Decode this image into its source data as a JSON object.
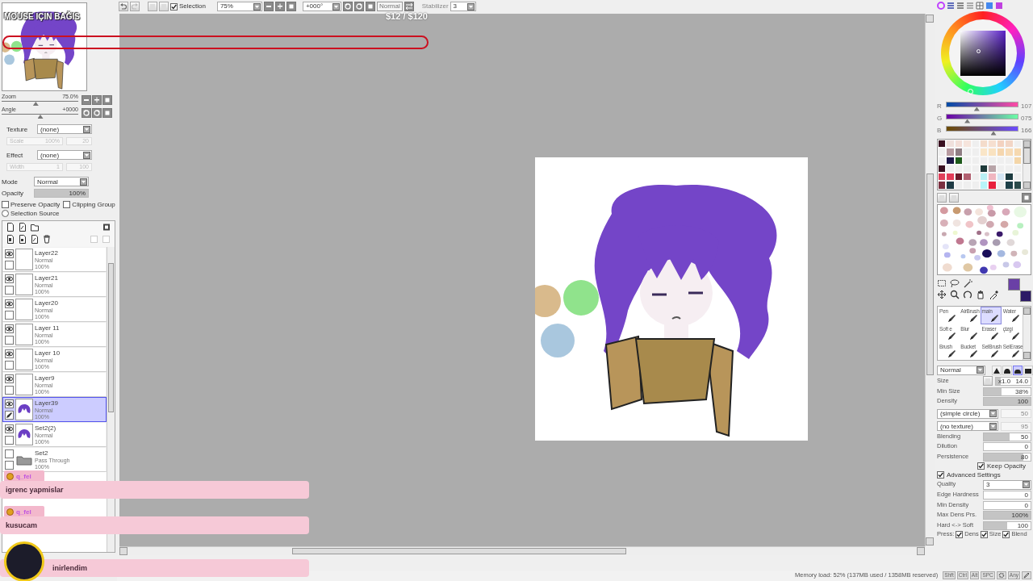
{
  "toolbar": {
    "selection": {
      "label": "Selection",
      "checked": true
    },
    "zoom": "75%",
    "angle": "+000°",
    "blend_button": "Normal",
    "stabilizer_label": "Stabilizer",
    "stabilizer": "3"
  },
  "stream_overlay": {
    "title": "MOUSE IÇIN BAĞIS",
    "amount": "$12 / $120"
  },
  "navigator": {
    "zoom": {
      "label": "Zoom",
      "value": "75.0%",
      "level": 0.44
    },
    "angle": {
      "label": "Angle",
      "value": "+0000",
      "level": 0.5
    }
  },
  "layer_properties": {
    "texture": {
      "label": "Texture",
      "value": "(none)",
      "sub_label": "Scale",
      "sub_value": "100%",
      "amount": "20"
    },
    "effect": {
      "label": "Effect",
      "value": "(none)",
      "sub_label": "Width",
      "sub_value": "1",
      "amount": "100"
    },
    "mode": {
      "label": "Mode",
      "value": "Normal"
    },
    "opacity": {
      "label": "Opacity",
      "value": "100%",
      "level": 1
    },
    "options": [
      {
        "kind": "checkbox",
        "label": "Preserve Opacity",
        "checked": false
      },
      {
        "kind": "checkbox",
        "label": "Clipping Group",
        "checked": false
      },
      {
        "kind": "radio",
        "label": "Selection Source",
        "checked": false
      }
    ]
  },
  "layers": [
    {
      "kind": "empty",
      "name": "Layer22",
      "mode": "Normal",
      "opacity": "100%",
      "visible": true,
      "selected": false
    },
    {
      "kind": "empty",
      "name": "Layer21",
      "mode": "Normal",
      "opacity": "100%",
      "visible": true,
      "selected": false
    },
    {
      "kind": "empty",
      "name": "Layer20",
      "mode": "Normal",
      "opacity": "100%",
      "visible": true,
      "selected": false
    },
    {
      "kind": "empty",
      "name": "Layer 11",
      "mode": "Normal",
      "opacity": "100%",
      "visible": true,
      "selected": false
    },
    {
      "kind": "empty",
      "name": "Layer 10",
      "mode": "Normal",
      "opacity": "100%",
      "visible": true,
      "selected": false
    },
    {
      "kind": "empty",
      "name": "Layer9",
      "mode": "Normal",
      "opacity": "100%",
      "visible": true,
      "selected": false
    },
    {
      "kind": "painted",
      "name": "Layer39",
      "mode": "Normal",
      "opacity": "100%",
      "visible": true,
      "selected": true
    },
    {
      "kind": "painted",
      "name": "Set2(2)",
      "mode": "Normal",
      "opacity": "100%",
      "visible": true,
      "selected": false
    },
    {
      "kind": "folder",
      "name": "Set2",
      "mode": "Pass Through",
      "opacity": "100%",
      "visible": false,
      "selected": false
    }
  ],
  "chat": [
    {
      "kind": "badge",
      "user": "q_fel",
      "message": "igrenc yapmislar"
    },
    {
      "kind": "badge",
      "user": "q_fel",
      "message": "kusucam"
    },
    {
      "kind": "avatar",
      "message": "inirlendim"
    }
  ],
  "color_panel": {
    "channels": [
      {
        "label": "R",
        "value": "107",
        "level": 0.42
      },
      {
        "label": "G",
        "value": "075",
        "level": 0.29
      },
      {
        "label": "B",
        "value": "166",
        "level": 0.65
      }
    ],
    "swatches": [
      {
        "color": "#3a1020"
      },
      {
        "color": "#f0e0dc"
      },
      {
        "color": "#f3ded8"
      },
      {
        "color": "#f6e4dc"
      },
      {
        "color": "#efefef"
      },
      {
        "color": "#f4dccb"
      },
      {
        "color": "#f6dfd0"
      },
      {
        "color": "#f3d2c0"
      },
      {
        "color": "#f2d6c6"
      },
      {
        "color": "#efefef"
      },
      {
        "color": "#efefef"
      },
      {
        "color": "#b79aa0"
      },
      {
        "color": "#8f7e84"
      },
      {
        "color": "#efefef"
      },
      {
        "color": "#efefef"
      },
      {
        "color": "#fae6c8"
      },
      {
        "color": "#f9e2c0"
      },
      {
        "color": "#f5d6ae"
      },
      {
        "color": "#f7dcb8"
      },
      {
        "color": "#f6d9b0"
      },
      {
        "color": "#efefef"
      },
      {
        "color": "#1b1646"
      },
      {
        "color": "#1d5a1a"
      },
      {
        "color": "#efefef"
      },
      {
        "color": "#efefef"
      },
      {
        "color": "#efefef"
      },
      {
        "color": "#efefef"
      },
      {
        "color": "#efefef"
      },
      {
        "color": "#efefef"
      },
      {
        "color": "#f4d6a8"
      },
      {
        "color": "#3a1020"
      },
      {
        "color": "#efefef"
      },
      {
        "color": "#efefef"
      },
      {
        "color": "#efefef"
      },
      {
        "color": "#efefef"
      },
      {
        "color": "#1e3a3a"
      },
      {
        "color": "#b8a4a8"
      },
      {
        "color": "#efefef"
      },
      {
        "color": "#efefef"
      },
      {
        "color": "#efefef"
      },
      {
        "color": "#e0405a"
      },
      {
        "color": "#e23c58"
      },
      {
        "color": "#6a1a2a"
      },
      {
        "color": "#b26070"
      },
      {
        "color": "#efefef"
      },
      {
        "color": "#b8f0f4"
      },
      {
        "color": "#f0b6c0"
      },
      {
        "color": "#d4e6f4"
      },
      {
        "color": "#1e3c40"
      },
      {
        "color": "#efefef"
      },
      {
        "color": "#7a3040"
      },
      {
        "color": "#1e3a44"
      },
      {
        "color": "#efefef"
      },
      {
        "color": "#efefef"
      },
      {
        "color": "#efefef"
      },
      {
        "color": "#b8f4f8"
      },
      {
        "color": "#e8203c"
      },
      {
        "color": "#efefef"
      },
      {
        "color": "#1e4048"
      },
      {
        "color": "#2a4a4a"
      }
    ],
    "primary": {
      "color": "#6a40a6"
    },
    "secondary": {
      "color": "#2c1a66"
    }
  },
  "brushes": [
    {
      "label": "Pen",
      "selected": false
    },
    {
      "label": "AirBrush",
      "selected": false
    },
    {
      "label": "main",
      "selected": true
    },
    {
      "label": "Water",
      "selected": false
    },
    {
      "label": "Soft e",
      "selected": false
    },
    {
      "label": "Blur",
      "selected": false
    },
    {
      "label": "Eraser",
      "selected": false
    },
    {
      "label": "çizgi",
      "selected": false
    },
    {
      "label": "Brush",
      "selected": false
    },
    {
      "label": "Bucket",
      "selected": false
    },
    {
      "label": "SelBrush",
      "selected": false
    },
    {
      "label": "SelErase",
      "selected": false
    }
  ],
  "brush_settings": {
    "mode": "Normal",
    "shapes": [
      {
        "selected": false
      },
      {
        "selected": false
      },
      {
        "selected": true
      },
      {
        "selected": false
      }
    ],
    "rows": [
      {
        "kind": "size",
        "label": "Size",
        "multiplier": "x1.0",
        "value": "14.0",
        "level": 0.14
      },
      {
        "kind": "slider",
        "label": "Min Size",
        "value": "38%",
        "level": 0.38
      },
      {
        "kind": "slider",
        "label": "Density",
        "value": "100",
        "level": 1
      },
      {
        "kind": "dropdown",
        "value": "(simple circle)",
        "amount": "50"
      },
      {
        "kind": "dropdown",
        "value": "(no texture)",
        "amount": "95"
      },
      {
        "kind": "slider",
        "label": "Blending",
        "value": "50",
        "level": 0.55
      },
      {
        "kind": "slider",
        "label": "Dilution",
        "value": "0",
        "level": 0
      },
      {
        "kind": "slider",
        "label": "Persistence",
        "value": "80",
        "level": 0.85
      },
      {
        "kind": "check",
        "label": "Keep Opacity",
        "checked": true
      },
      {
        "kind": "check",
        "label": "Advanced Settings",
        "checked": true
      },
      {
        "kind": "select",
        "label": "Quality",
        "value": "3"
      },
      {
        "kind": "slider",
        "label": "Edge Hardness",
        "value": "0",
        "level": 0
      },
      {
        "kind": "slider",
        "label": "Min Density",
        "value": "0",
        "level": 0
      },
      {
        "kind": "slider",
        "label": "Max Dens Prs.",
        "value": "100%",
        "level": 1
      },
      {
        "kind": "slider",
        "label": "Hard <-> Soft",
        "value": "100",
        "level": 0.5
      },
      {
        "kind": "press",
        "label": "Press:",
        "options": [
          {
            "label": "Dens",
            "checked": true
          },
          {
            "label": "Size",
            "checked": true
          },
          {
            "label": "Blend",
            "checked": true
          }
        ]
      }
    ]
  },
  "status_bar": {
    "memory": "Memory load: 52% (137MB used / 1358MB reserved)",
    "keys": [
      {
        "label": "Shft"
      },
      {
        "label": "Ctrl"
      },
      {
        "label": "Alt"
      },
      {
        "label": "SPC"
      }
    ],
    "any": "Any"
  }
}
